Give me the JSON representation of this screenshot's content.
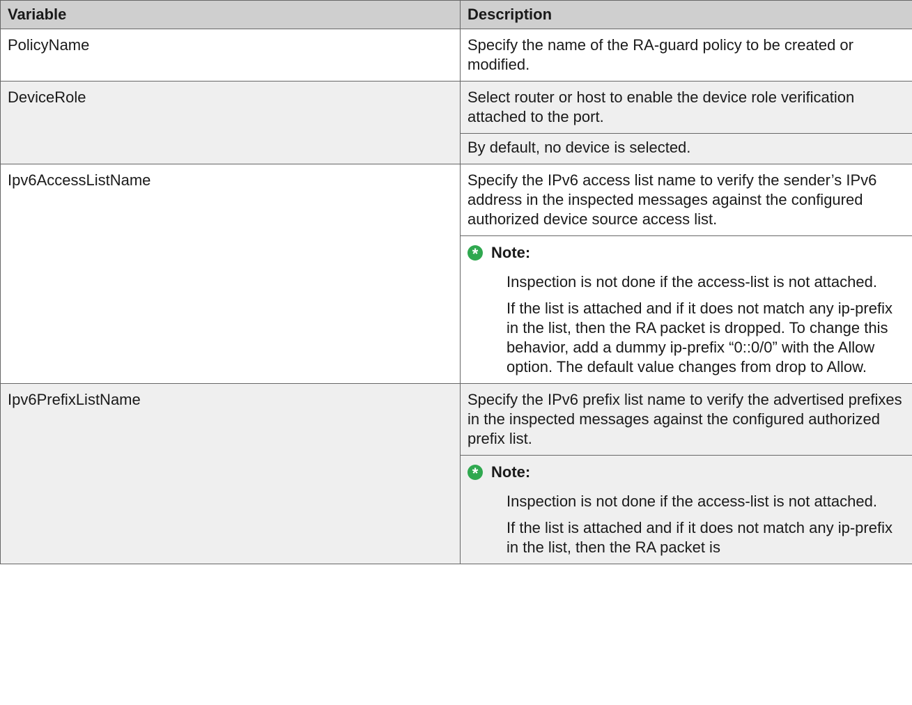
{
  "table": {
    "headers": {
      "variable": "Variable",
      "description": "Description"
    },
    "rows": [
      {
        "variable": "PolicyName",
        "paragraphs": [
          "Specify the name of the RA-guard policy to be created or modified."
        ]
      },
      {
        "variable": "DeviceRole",
        "paragraphs": [
          "Select router or host to enable the device role verification attached to the port.",
          "By default, no device is selected."
        ]
      },
      {
        "variable": "Ipv6AccessListName",
        "paragraphs": [
          "Specify the IPv6 access list name to verify the sender’s IPv6 address in the inspected messages against the configured authorized device source access list."
        ],
        "note": {
          "label": "Note:",
          "paragraphs": [
            "Inspection is not done if the access-list is not attached.",
            "If the list is attached and if it does not match any ip-prefix in the list, then the RA packet is dropped. To change this behavior, add a dummy ip-prefix “0::0/0” with the Allow option. The default value changes from drop to Allow."
          ]
        }
      },
      {
        "variable": "Ipv6PrefixListName",
        "paragraphs": [
          "Specify the IPv6 prefix list name to verify the advertised prefixes in the inspected messages against the configured authorized prefix list."
        ],
        "note": {
          "label": "Note:",
          "paragraphs": [
            "Inspection is not done if the access-list is not attached.",
            "If the list is attached and if it does not match any ip-prefix in the list, then the RA packet is"
          ]
        }
      }
    ]
  },
  "icons": {
    "note": "note-asterisk-icon"
  },
  "colors": {
    "header_bg": "#cfcfcf",
    "stripe_bg": "#efefef",
    "note_icon": "#2fa84f"
  }
}
